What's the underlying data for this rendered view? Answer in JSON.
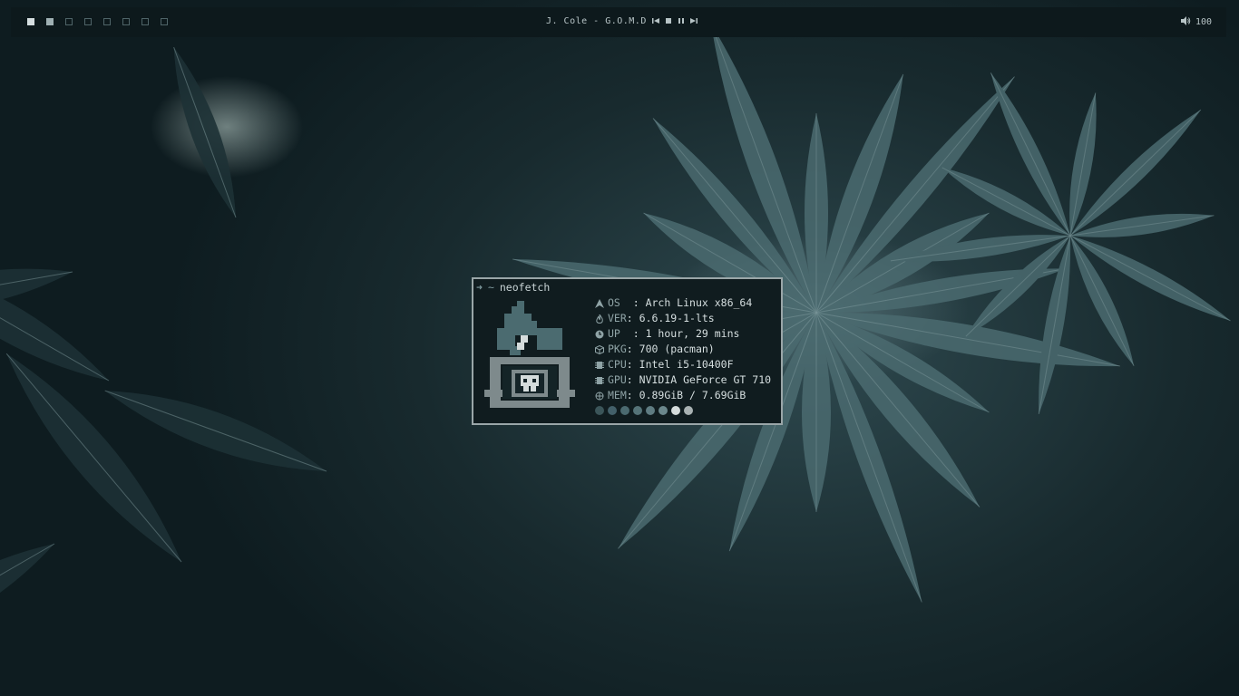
{
  "topbar": {
    "workspaces": [
      {
        "state": "active"
      },
      {
        "state": "occupied"
      },
      {
        "state": "empty"
      },
      {
        "state": "empty"
      },
      {
        "state": "empty"
      },
      {
        "state": "empty"
      },
      {
        "state": "empty"
      },
      {
        "state": "empty"
      }
    ],
    "media": {
      "track": "J. Cole - G.O.M.D",
      "prev_icon": "skip-previous-icon",
      "stop_icon": "stop-icon",
      "pause_icon": "pause-icon",
      "next_icon": "skip-next-icon"
    },
    "volume": {
      "icon": "speaker-icon",
      "level": "100"
    }
  },
  "terminal": {
    "prompt": {
      "arrow": "➜",
      "cwd": "~",
      "command": "neofetch"
    },
    "ascii_art": "arch-linux-skull-logo",
    "info": [
      {
        "icon": "arch-logo-icon",
        "key": "OS ",
        "value": "Arch Linux x86_64"
      },
      {
        "icon": "flame-icon",
        "key": "VER",
        "value": "6.6.19-1-lts"
      },
      {
        "icon": "clock-icon",
        "key": "UP ",
        "value": "1 hour, 29 mins"
      },
      {
        "icon": "package-icon",
        "key": "PKG",
        "value": "700 (pacman)"
      },
      {
        "icon": "chip-icon",
        "key": "CPU",
        "value": "Intel i5-10400F"
      },
      {
        "icon": "chip-icon",
        "key": "GPU",
        "value": "NVIDIA GeForce GT 710"
      },
      {
        "icon": "memory-icon",
        "key": "MEM",
        "value": "0.89GiB / 7.69GiB"
      }
    ],
    "palette": [
      "#3b5559",
      "#43606a",
      "#4b6a70",
      "#557378",
      "#5f7c82",
      "#6b878c",
      "#d5dcdc",
      "#a9b2b3"
    ]
  },
  "colors": {
    "bar_bg": "#0d191c",
    "terminal_bg": "#101c1f",
    "terminal_border": "#9aa6a8",
    "text": "#c9d4d6"
  }
}
